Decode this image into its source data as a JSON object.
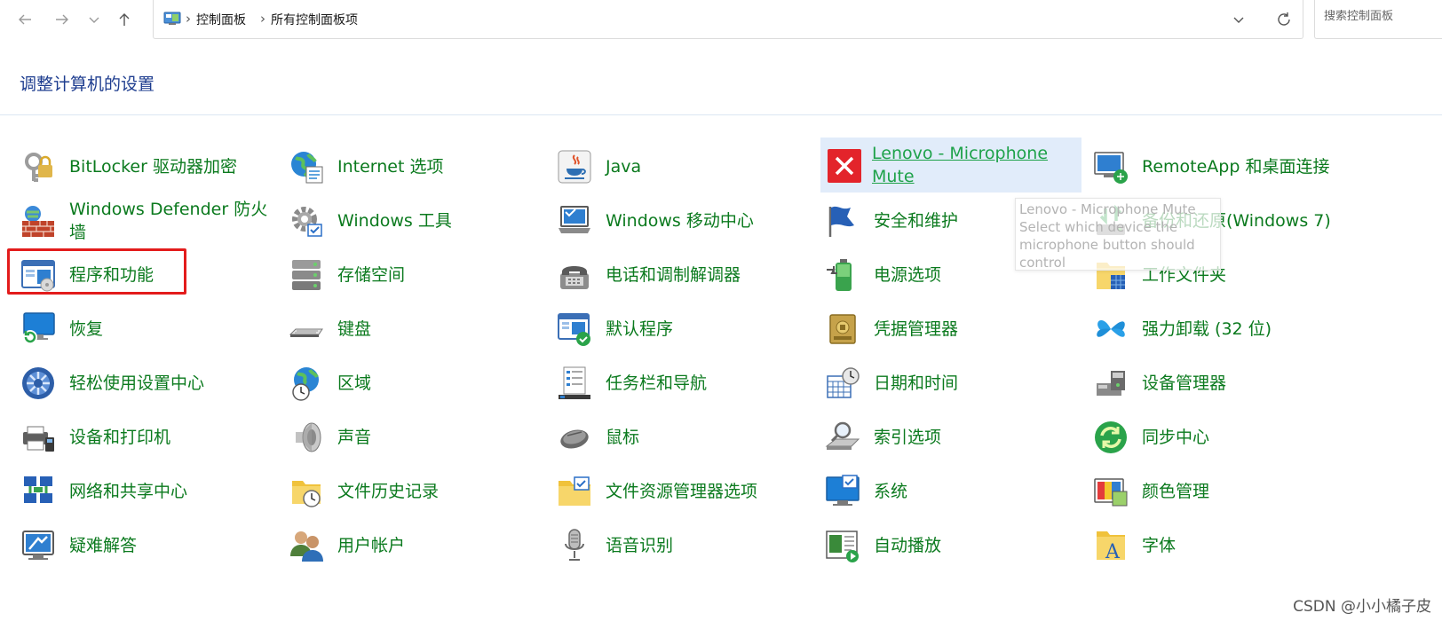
{
  "breadcrumb": [
    "控制面板",
    "所有控制面板项"
  ],
  "search": {
    "placeholder": "搜索控制面板"
  },
  "heading": "调整计算机的设置",
  "columns": [
    [
      {
        "label": "BitLocker 驱动器加密",
        "icon": "bitlocker-icon"
      },
      {
        "label": "Windows Defender 防火墙",
        "icon": "firewall-icon"
      },
      {
        "label": "程序和功能",
        "icon": "programs-features-icon"
      },
      {
        "label": "恢复",
        "icon": "recovery-icon"
      },
      {
        "label": "轻松使用设置中心",
        "icon": "ease-of-access-icon"
      },
      {
        "label": "设备和打印机",
        "icon": "printer-icon"
      },
      {
        "label": "网络和共享中心",
        "icon": "network-icon"
      },
      {
        "label": "疑难解答",
        "icon": "troubleshoot-icon"
      }
    ],
    [
      {
        "label": "Internet 选项",
        "icon": "globe-icon"
      },
      {
        "label": "Windows 工具",
        "icon": "gear-icon"
      },
      {
        "label": "存储空间",
        "icon": "storage-icon"
      },
      {
        "label": "键盘",
        "icon": "keyboard-icon"
      },
      {
        "label": "区域",
        "icon": "region-icon"
      },
      {
        "label": "声音",
        "icon": "speaker-icon"
      },
      {
        "label": "文件历史记录",
        "icon": "file-history-icon"
      },
      {
        "label": "用户帐户",
        "icon": "users-icon"
      }
    ],
    [
      {
        "label": "Java",
        "icon": "java-icon"
      },
      {
        "label": "Windows 移动中心",
        "icon": "mobility-center-icon"
      },
      {
        "label": "电话和调制解调器",
        "icon": "phone-modem-icon"
      },
      {
        "label": "默认程序",
        "icon": "default-programs-icon"
      },
      {
        "label": "任务栏和导航",
        "icon": "taskbar-icon"
      },
      {
        "label": "鼠标",
        "icon": "mouse-icon"
      },
      {
        "label": "文件资源管理器选项",
        "icon": "folder-options-icon"
      },
      {
        "label": "语音识别",
        "icon": "microphone-icon"
      }
    ],
    [
      {
        "label": "Lenovo - Microphone Mute",
        "icon": "mic-mute-icon"
      },
      {
        "label": "安全和维护",
        "icon": "flag-icon"
      },
      {
        "label": "电源选项",
        "icon": "battery-icon"
      },
      {
        "label": "凭据管理器",
        "icon": "credential-icon"
      },
      {
        "label": "日期和时间",
        "icon": "calendar-clock-icon"
      },
      {
        "label": "索引选项",
        "icon": "indexing-icon"
      },
      {
        "label": "系统",
        "icon": "system-monitor-icon"
      },
      {
        "label": "自动播放",
        "icon": "autoplay-icon"
      }
    ],
    [
      {
        "label": "RemoteApp 和桌面连接",
        "icon": "remoteapp-icon"
      },
      {
        "label": "备份和还原(Windows 7)",
        "icon": "backup-icon"
      },
      {
        "label": "工作文件夹",
        "icon": "work-folders-icon"
      },
      {
        "label": "强力卸载 (32 位)",
        "icon": "uninstall-icon"
      },
      {
        "label": "设备管理器",
        "icon": "device-manager-icon"
      },
      {
        "label": "同步中心",
        "icon": "sync-icon"
      },
      {
        "label": "颜色管理",
        "icon": "color-management-icon"
      },
      {
        "label": "字体",
        "icon": "fonts-icon"
      }
    ]
  ],
  "highlighted_item": "Lenovo - Microphone Mute",
  "selected_item": "程序和功能",
  "tooltip": "Lenovo - Microphone Mute\nSelect which device the microphone button should control",
  "watermark": "CSDN @小小橘子皮",
  "colors": {
    "link": "#0b7a1e",
    "heading": "#1e3d8f",
    "selection_box": "#e31c1c",
    "hover_bg": "#e1ecfa"
  }
}
